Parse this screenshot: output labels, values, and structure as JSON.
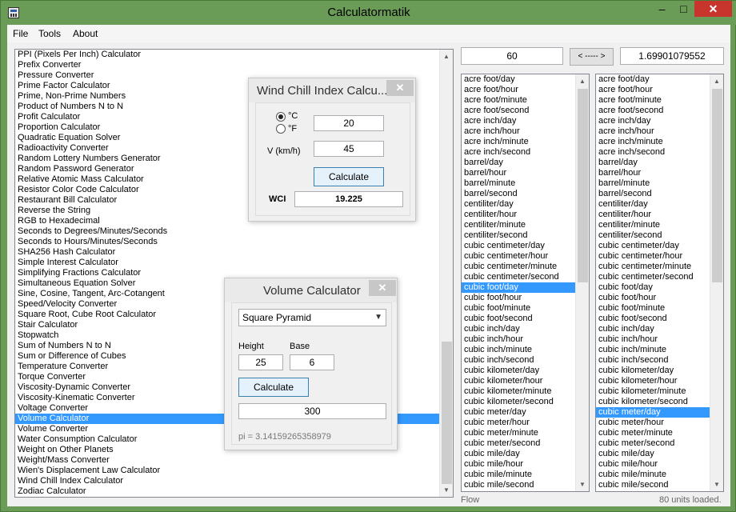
{
  "window": {
    "title": "Calculatormatik"
  },
  "menu": {
    "file": "File",
    "tools": "Tools",
    "about": "About"
  },
  "calculators": [
    "PPI (Pixels Per Inch) Calculator",
    "Prefix Converter",
    "Pressure Converter",
    "Prime Factor Calculator",
    "Prime, Non-Prime Numbers",
    "Product of Numbers N to N",
    "Profit Calculator",
    "Proportion Calculator",
    "Quadratic Equation Solver",
    "Radioactivity Converter",
    "Random Lottery Numbers Generator",
    "Random Password Generator",
    "Relative Atomic Mass Calculator",
    "Resistor Color Code Calculator",
    "Restaurant Bill Calculator",
    "Reverse the String",
    "RGB to Hexadecimal",
    "Seconds to Degrees/Minutes/Seconds",
    "Seconds to Hours/Minutes/Seconds",
    "SHA256 Hash Calculator",
    "Simple Interest Calculator",
    "Simplifying Fractions Calculator",
    "Simultaneous Equation Solver",
    "Sine, Cosine, Tangent, Arc-Cotangent",
    "Speed/Velocity Converter",
    "Square Root, Cube Root Calculator",
    "Stair Calculator",
    "Stopwatch",
    "Sum of Numbers N to N",
    "Sum or Difference of Cubes",
    "Temperature Converter",
    "Torque Converter",
    "Viscosity-Dynamic Converter",
    "Viscosity-Kinematic Converter",
    "Voltage Converter",
    "Volume Calculator",
    "Volume Converter",
    "Water Consumption Calculator",
    "Weight on Other Planets",
    "Weight/Mass Converter",
    "Wien's Displacement Law Calculator",
    "Wind Chill Index Calculator",
    "Zodiac Calculator"
  ],
  "selected_calculator": "Volume Calculator",
  "converter": {
    "left_value": "60",
    "swap_label": "< ----- >",
    "right_value": "1.69901079552",
    "units": [
      "acre foot/day",
      "acre foot/hour",
      "acre foot/minute",
      "acre foot/second",
      "acre inch/day",
      "acre inch/hour",
      "acre inch/minute",
      "acre inch/second",
      "barrel/day",
      "barrel/hour",
      "barrel/minute",
      "barrel/second",
      "centiliter/day",
      "centiliter/hour",
      "centiliter/minute",
      "centiliter/second",
      "cubic centimeter/day",
      "cubic centimeter/hour",
      "cubic centimeter/minute",
      "cubic centimeter/second",
      "cubic foot/day",
      "cubic foot/hour",
      "cubic foot/minute",
      "cubic foot/second",
      "cubic inch/day",
      "cubic inch/hour",
      "cubic inch/minute",
      "cubic inch/second",
      "cubic kilometer/day",
      "cubic kilometer/hour",
      "cubic kilometer/minute",
      "cubic kilometer/second",
      "cubic meter/day",
      "cubic meter/hour",
      "cubic meter/minute",
      "cubic meter/second",
      "cubic mile/day",
      "cubic mile/hour",
      "cubic mile/minute",
      "cubic mile/second"
    ],
    "left_selected": "cubic foot/day",
    "right_selected": "cubic meter/day",
    "status_left": "Flow",
    "status_right": "80 units loaded."
  },
  "wind_chill": {
    "title": "Wind Chill Index Calcu...",
    "close": "✕",
    "celsius_label": "°C",
    "fahrenheit_label": "°F",
    "unit_selected": "°C",
    "temperature": "20",
    "wind_label": "V (km/h)",
    "wind": "45",
    "calculate_label": "Calculate",
    "result_label": "WCI",
    "result": "19.225"
  },
  "volume": {
    "title": "Volume Calculator",
    "close": "✕",
    "shape": "Square Pyramid",
    "height_label": "Height",
    "base_label": "Base",
    "height": "25",
    "base": "6",
    "calculate_label": "Calculate",
    "result": "300",
    "pi_text": "pi = 3.14159265358979"
  }
}
